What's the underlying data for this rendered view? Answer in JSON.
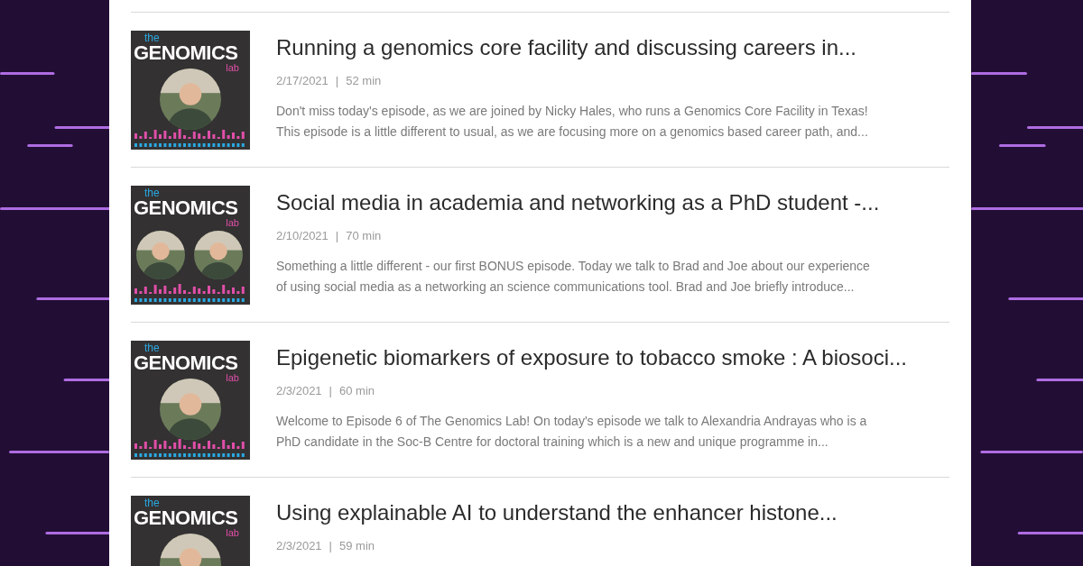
{
  "episodes": [
    {
      "cover": {
        "top": "the",
        "title": "GENOMICS",
        "bottom": "lab",
        "kind": "single",
        "bars": true
      },
      "title": "Running a genomics core facility and discussing careers in...",
      "date": "2/17/2021",
      "separator": "|",
      "duration": "52 min",
      "description": [
        "Don't miss today's episode, as we are joined by Nicky Hales, who runs a Genomics Core Facility in Texas!",
        "This episode is a little different to usual, as we are focusing more on a genomics based career path, and..."
      ]
    },
    {
      "cover": {
        "top": "the",
        "title": "GENOMICS",
        "bottom": "lab",
        "kind": "pair",
        "bars": true
      },
      "title": "Social media in academia and networking as a PhD student -...",
      "date": "2/10/2021",
      "separator": "|",
      "duration": "70 min",
      "description": [
        "Something a little different - our first BONUS episode. Today we talk to Brad and Joe about our experience",
        "of using social media as a networking an science communications tool. Brad and Joe briefly introduce..."
      ]
    },
    {
      "cover": {
        "top": "the",
        "title": "GENOMICS",
        "bottom": "lab",
        "kind": "single",
        "bars": true
      },
      "title": "Epigenetic biomarkers of exposure to tobacco smoke : A biosoci...",
      "date": "2/3/2021",
      "separator": "|",
      "duration": "60 min",
      "description": [
        "Welcome to Episode 6 of The Genomics Lab! On today's episode we talk to Alexandria Andrayas who is a",
        "PhD candidate in the Soc-B Centre for doctoral training which is a new and unique programme in..."
      ]
    },
    {
      "cover": {
        "top": "the",
        "title": "GENOMICS",
        "bottom": "lab",
        "kind": "single"
      },
      "title": "Using explainable AI to understand the enhancer histone...",
      "date": "2/3/2021",
      "separator": "|",
      "duration": "59 min"
    }
  ]
}
